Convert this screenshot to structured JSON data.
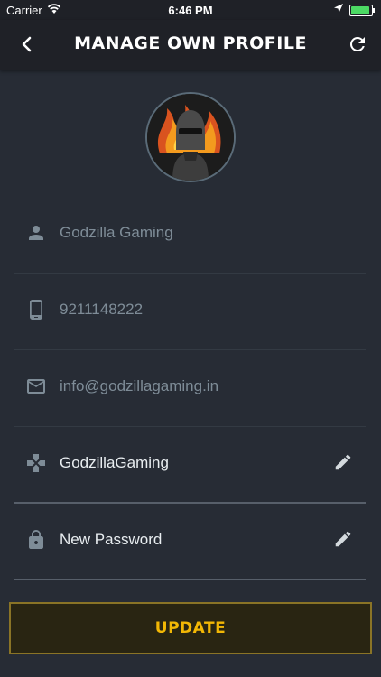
{
  "status_bar": {
    "carrier": "Carrier",
    "time": "6:46 PM",
    "battery_level": 0.9
  },
  "header": {
    "title": "MANAGE OWN PROFILE",
    "back_icon": "chevron-left-icon",
    "refresh_icon": "refresh-icon"
  },
  "profile": {
    "avatar": "avatar-icon"
  },
  "fields": [
    {
      "icon": "person-icon",
      "value": "Godzilla Gaming"
    },
    {
      "icon": "phone-icon",
      "value": "9211148222"
    },
    {
      "icon": "email-icon",
      "value": "info@godzillagaming.in"
    },
    {
      "icon": "gamepad-icon",
      "value": "GodzillaGaming",
      "editable": true
    },
    {
      "icon": "lock-icon",
      "value": "New Password",
      "editable": true
    }
  ],
  "update_button": {
    "label": "UPDATE"
  },
  "colors": {
    "background": "#272c35",
    "bar": "#1f2127",
    "accent": "#f2b705",
    "muted": "#7e8c97"
  }
}
